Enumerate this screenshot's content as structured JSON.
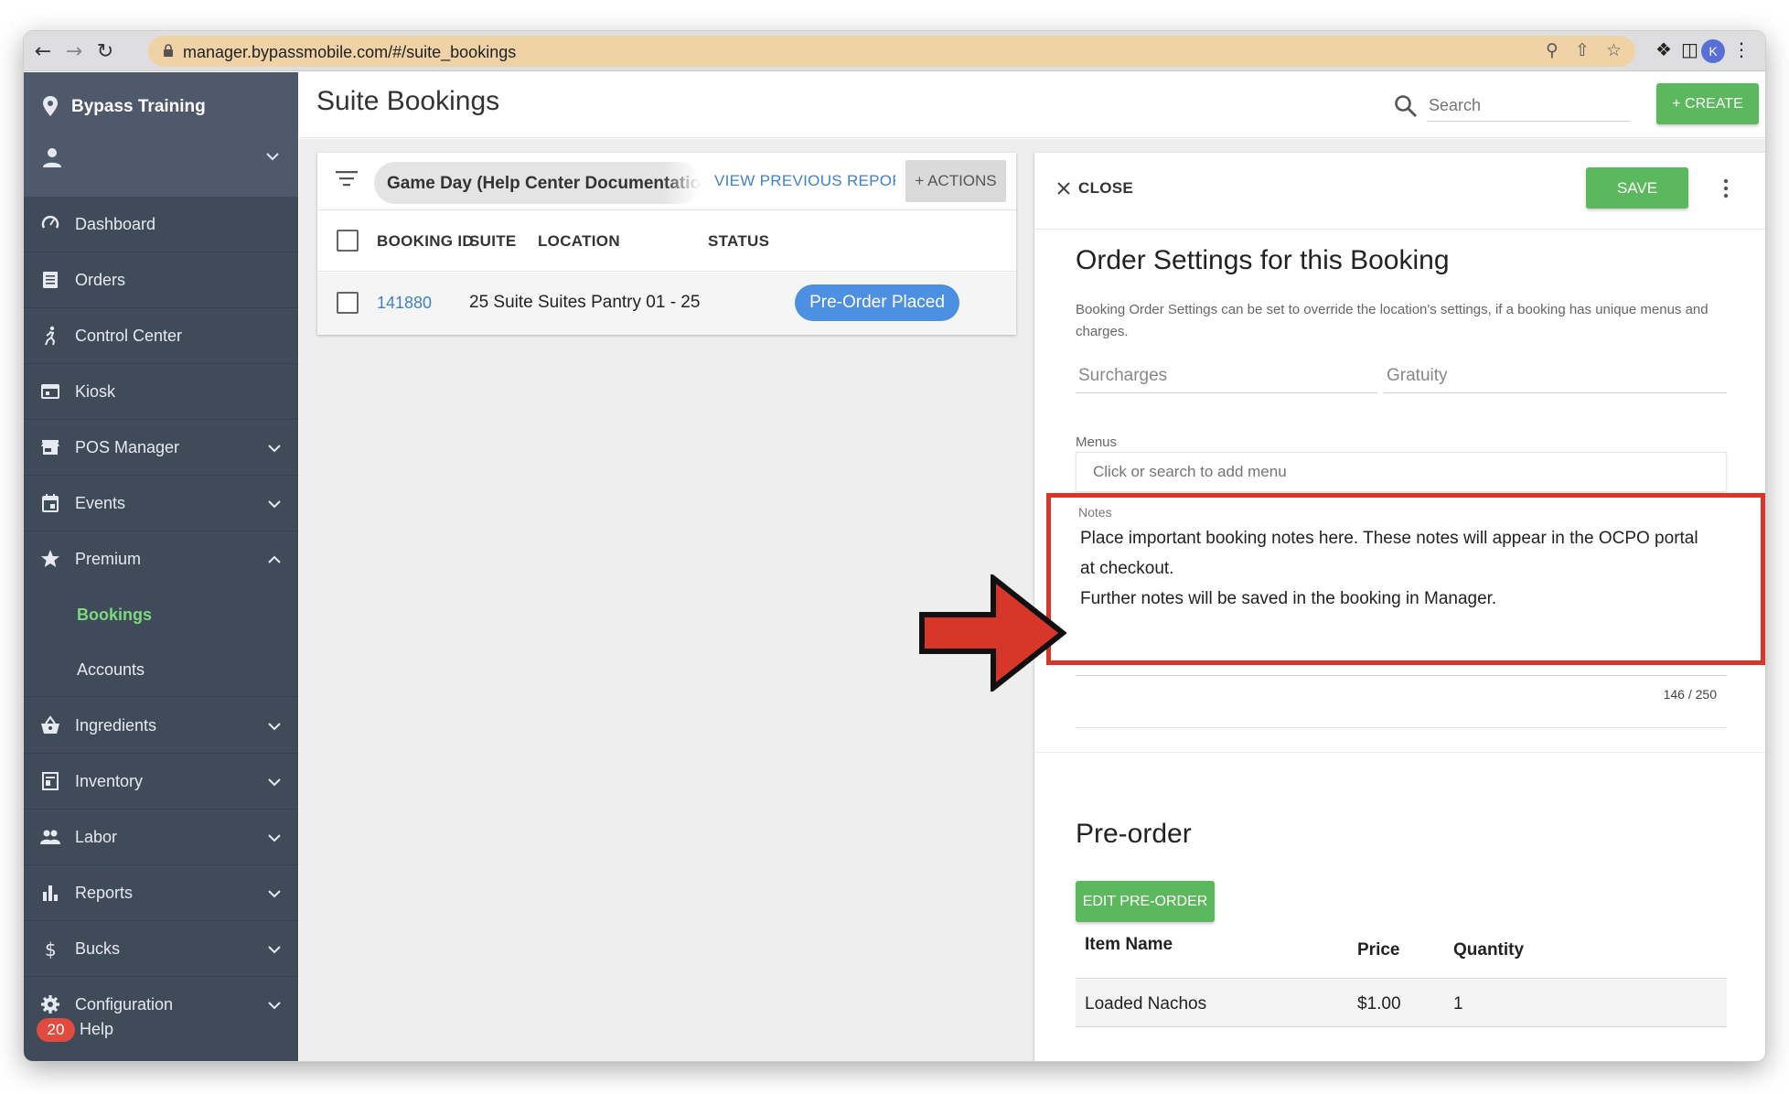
{
  "browser": {
    "url": "manager.bypassmobile.com/#/suite_bookings",
    "avatar_initial": "K"
  },
  "sidebar": {
    "org_name": "Bypass Training",
    "items": [
      {
        "label": "Dashboard",
        "icon": "dashboard-icon",
        "has_chevron": false
      },
      {
        "label": "Orders",
        "icon": "receipt-icon",
        "has_chevron": false
      },
      {
        "label": "Control Center",
        "icon": "runner-icon",
        "has_chevron": false
      },
      {
        "label": "Kiosk",
        "icon": "kiosk-icon",
        "has_chevron": false
      },
      {
        "label": "POS Manager",
        "icon": "store-icon",
        "has_chevron": true
      },
      {
        "label": "Events",
        "icon": "calendar-icon",
        "has_chevron": true
      },
      {
        "label": "Premium",
        "icon": "star-icon",
        "has_chevron": true,
        "expanded": true
      },
      {
        "label": "Ingredients",
        "icon": "basket-icon",
        "has_chevron": true
      },
      {
        "label": "Inventory",
        "icon": "inventory-icon",
        "has_chevron": true
      },
      {
        "label": "Labor",
        "icon": "people-icon",
        "has_chevron": true
      },
      {
        "label": "Reports",
        "icon": "bar-chart-icon",
        "has_chevron": true
      },
      {
        "label": "Bucks",
        "icon": "dollar-icon",
        "has_chevron": true
      },
      {
        "label": "Configuration",
        "icon": "gear-icon",
        "has_chevron": true
      }
    ],
    "premium_sub": [
      {
        "label": "Bookings",
        "active": true
      },
      {
        "label": "Accounts",
        "active": false
      }
    ],
    "help": {
      "badge": "20",
      "label": "Help"
    }
  },
  "header": {
    "title": "Suite Bookings",
    "search_placeholder": "Search",
    "create_label": "+ CREATE"
  },
  "list": {
    "report_chip": "Game Day (Help Center Documentation)",
    "view_previous": "VIEW PREVIOUS REPORTS",
    "actions_label": "+ ACTIONS",
    "columns": [
      "BOOKING ID",
      "SUITE",
      "LOCATION",
      "STATUS"
    ],
    "rows": [
      {
        "booking_id": "141880",
        "suite": "25 Suite",
        "location": "Suites Pantry 01 - 25",
        "status": "Pre-Order Placed"
      }
    ]
  },
  "detail": {
    "close_label": "CLOSE",
    "save_label": "SAVE",
    "title": "Order Settings for this Booking",
    "description": "Booking Order Settings can be set to override the location's settings, if a booking has unique menus and charges.",
    "surcharges_label": "Surcharges",
    "gratuity_label": "Gratuity",
    "menus_label": "Menus",
    "menus_placeholder": "Click or search to add menu",
    "notes_label": "Notes",
    "notes_value": "Place important booking notes here. These notes will appear in the OCPO portal at checkout.\nFurther notes will be saved in the booking in Manager.",
    "notes_count": "146 / 250",
    "preorder_title": "Pre-order",
    "edit_preorder_label": "EDIT PRE-ORDER",
    "preorder_columns": [
      "Item Name",
      "Price",
      "Quantity"
    ],
    "preorder_rows": [
      {
        "item": "Loaded Nachos",
        "price": "$1.00",
        "qty": "1"
      }
    ]
  },
  "colors": {
    "sidebar_bg": "#404b5a",
    "accent_green": "#5cb85c",
    "link_blue": "#3e83c6",
    "status_blue": "#4d8fe0",
    "annotation_red": "#d9362a"
  }
}
